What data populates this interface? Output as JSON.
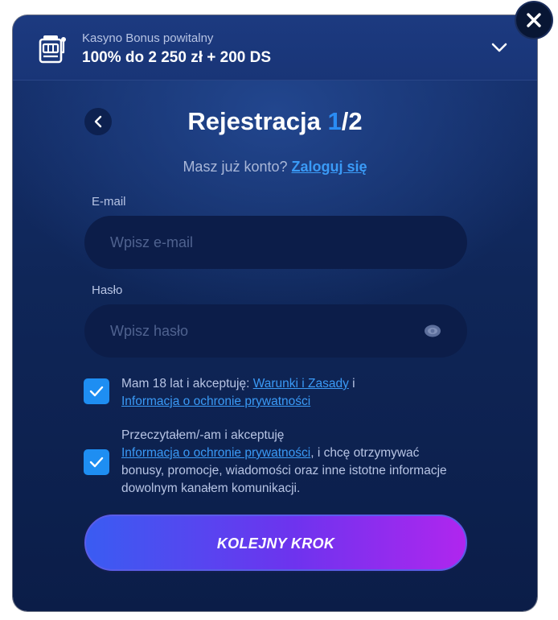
{
  "bonus": {
    "label": "Kasyno Bonus powitalny",
    "value": "100% do 2 250 zł + 200 DS"
  },
  "form": {
    "title_prefix": "Rejestracja ",
    "title_step": "1",
    "title_suffix": "/2",
    "login_prompt": "Masz już konto?",
    "login_link": "Zaloguj się",
    "email_label": "E-mail",
    "email_placeholder": "Wpisz e-mail",
    "email_value": "",
    "password_label": "Hasło",
    "password_placeholder": "Wpisz hasło",
    "password_value": "",
    "consent1": {
      "checked": true,
      "text_before": "Mam 18 lat i akceptuję: ",
      "link1": "Warunki i Zasady",
      "text_between": " i",
      "link2": "Informacja o ochronie prywatności"
    },
    "consent2": {
      "checked": true,
      "text_before": "Przeczytałem/-am i akceptuję",
      "link": "Informacja o ochronie prywatności",
      "text_after": ", i chcę otrzymywać bonusy, promocje, wiadomości oraz inne istotne informacje dowolnym kanałem komunikacji."
    },
    "next_button": "KOLEJNY KROK"
  },
  "icons": {
    "slot": "slot-machine-icon",
    "chevron": "chevron-down-icon",
    "close": "close-icon",
    "back": "chevron-left-icon",
    "eye": "eye-icon",
    "check": "checkmark-icon"
  },
  "colors": {
    "accent": "#2a8cf4",
    "link": "#3a9af6",
    "checkbox": "#1e8ef2",
    "button_start": "#3a5cf2",
    "button_end": "#b026ee"
  }
}
